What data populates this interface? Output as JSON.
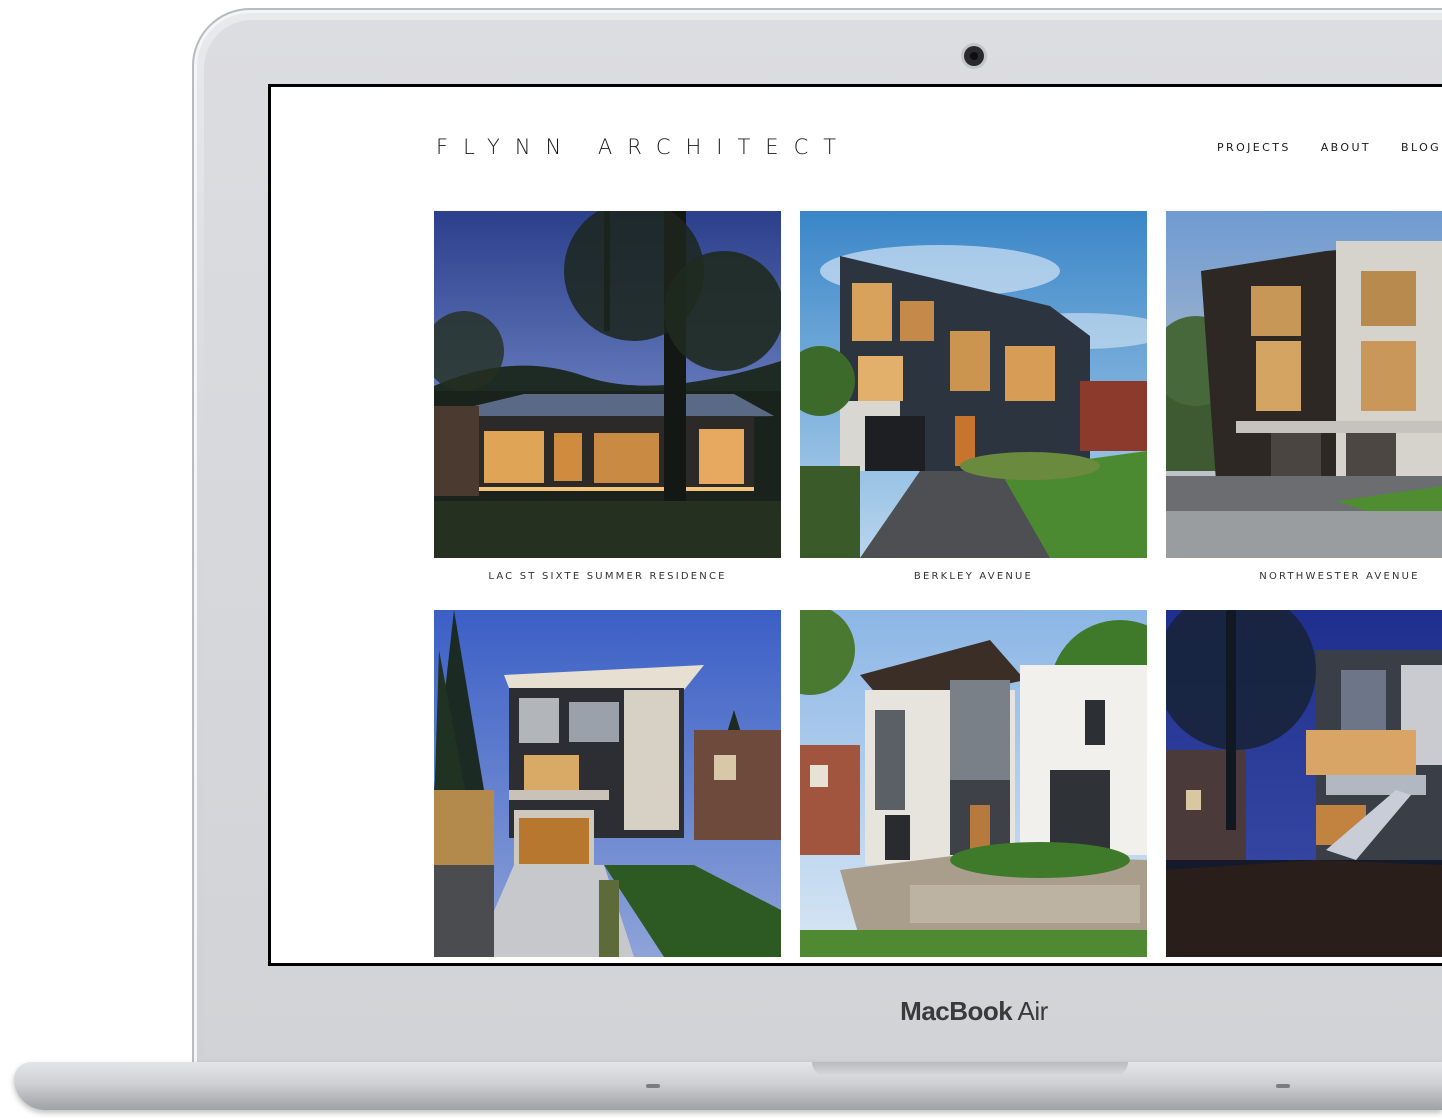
{
  "device": {
    "brand_bold": "MacBook",
    "brand_light": " Air"
  },
  "site": {
    "logo": "FLYNN ARCHITECT",
    "nav": [
      "PROJECTS",
      "ABOUT",
      "BLOG"
    ]
  },
  "projects": [
    {
      "title": "LAC ST SIXTE SUMMER RESIDENCE",
      "image": "dusk cabin among trees"
    },
    {
      "title": "BERKLEY AVENUE",
      "image": "modern three-storey house, blue sky"
    },
    {
      "title": "NORTHWESTER AVENUE",
      "image": "semi-detached modern houses at evening"
    },
    {
      "title": "",
      "image": "modern house at night with wood garage door"
    },
    {
      "title": "",
      "image": "white modern house with stone landscaping"
    },
    {
      "title": "",
      "image": "modern house at night with lit stairs"
    }
  ],
  "colors": {
    "background": "#ffffff",
    "text": "#1a1a1a",
    "laptop_silver": "#d7d9dc"
  }
}
